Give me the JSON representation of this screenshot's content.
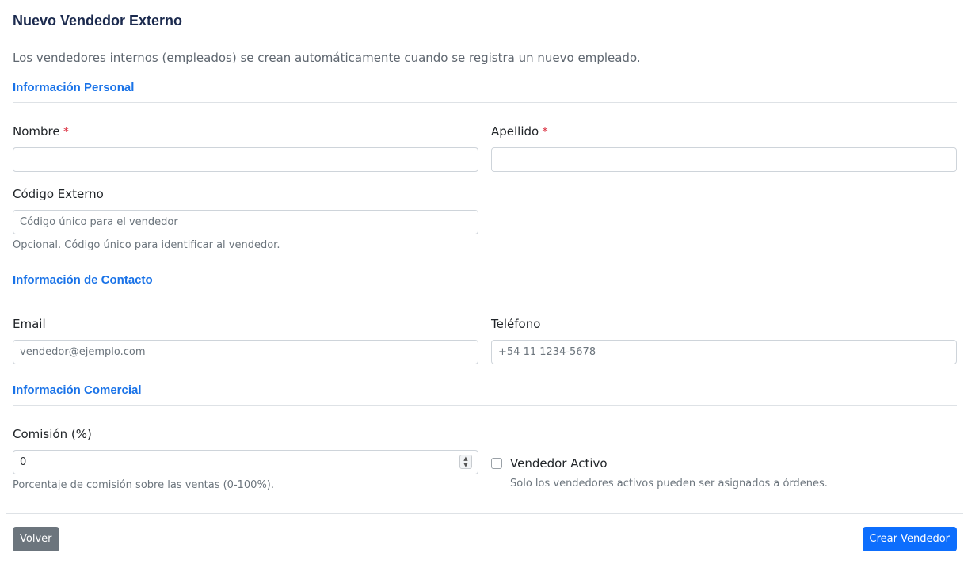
{
  "page": {
    "title": "Nuevo Vendedor Externo",
    "intro": "Los vendedores internos (empleados) se crean automáticamente cuando se registra un nuevo empleado."
  },
  "personal": {
    "section_title": "Información Personal",
    "nombre": {
      "label": "Nombre",
      "required_mark": "*",
      "value": ""
    },
    "apellido": {
      "label": "Apellido",
      "required_mark": "*",
      "value": ""
    },
    "codigo": {
      "label": "Código Externo",
      "placeholder": "Código único para el vendedor",
      "help": "Opcional. Código único para identificar al vendedor."
    }
  },
  "contacto": {
    "section_title": "Información de Contacto",
    "email": {
      "label": "Email",
      "placeholder": "vendedor@ejemplo.com"
    },
    "telefono": {
      "label": "Teléfono",
      "placeholder": "+54 11 1234-5678"
    }
  },
  "comercial": {
    "section_title": "Información Comercial",
    "comision": {
      "label": "Comisión (%)",
      "value": "0",
      "help": "Porcentaje de comisión sobre las ventas (0-100%)."
    },
    "activo": {
      "label": "Vendedor Activo",
      "checked": false,
      "help": "Solo los vendedores activos pueden ser asignados a órdenes."
    }
  },
  "actions": {
    "back_label": "Volver",
    "create_label": "Crear Vendedor"
  },
  "colors": {
    "title": "#1b2a4e",
    "section": "#1a73e8",
    "required": "#dc3545",
    "primary_button": "#0d6efd",
    "secondary_button": "#6c757d"
  }
}
